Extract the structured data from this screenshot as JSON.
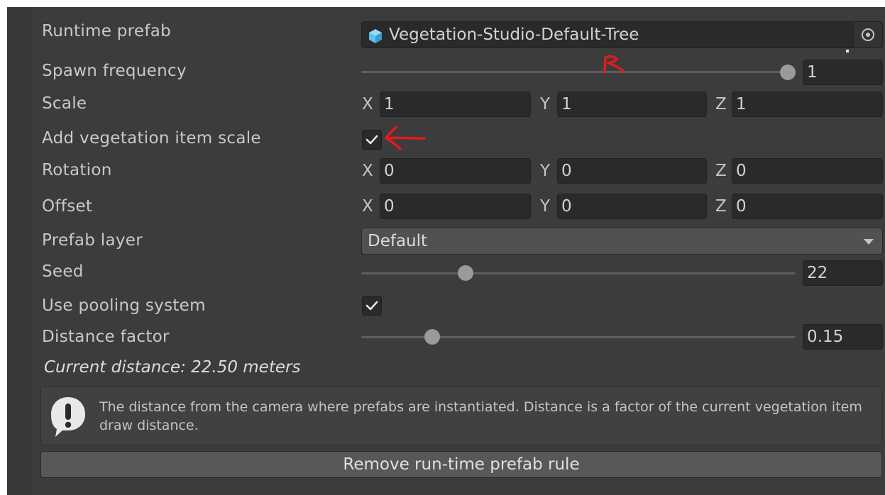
{
  "rows": {
    "runtime_prefab": {
      "label": "Runtime prefab",
      "value": "Vegetation-Studio-Default-Tree",
      "icon": "prefab-cube-icon"
    },
    "spawn_frequency": {
      "label": "Spawn frequency",
      "value": "1",
      "slider_fraction": 1.0
    },
    "scale": {
      "label": "Scale",
      "x_label": "X",
      "x": "1",
      "y_label": "Y",
      "y": "1",
      "z_label": "Z",
      "z": "1"
    },
    "add_vegetation_item_scale": {
      "label": "Add vegetation item scale",
      "checked": true
    },
    "rotation": {
      "label": "Rotation",
      "x_label": "X",
      "x": "0",
      "y_label": "Y",
      "y": "0",
      "z_label": "Z",
      "z": "0"
    },
    "offset": {
      "label": "Offset",
      "x_label": "X",
      "x": "0",
      "y_label": "Y",
      "y": "0",
      "z_label": "Z",
      "z": "0"
    },
    "prefab_layer": {
      "label": "Prefab layer",
      "value": "Default"
    },
    "seed": {
      "label": "Seed",
      "value": "22",
      "slider_fraction": 0.23
    },
    "use_pooling_system": {
      "label": "Use pooling system",
      "checked": true
    },
    "distance_factor": {
      "label": "Distance factor",
      "value": "0.15",
      "slider_fraction": 0.15
    }
  },
  "current_distance": "Current distance: 22.50 meters",
  "help": {
    "icon": "exclamation-info-icon",
    "text": "The distance from the camera where prefabs are instantiated. Distance is a factor of the current vegetation item draw distance."
  },
  "remove_button_label": "Remove run-time prefab rule",
  "colors": {
    "panel_bg": "#383838",
    "inner_bg": "#3c3c3c",
    "field_bg": "#2a2a2a",
    "button_bg": "#585858",
    "annotation_red": "#e11b1b",
    "prefab_icon_blue": "#5cc3f0"
  }
}
